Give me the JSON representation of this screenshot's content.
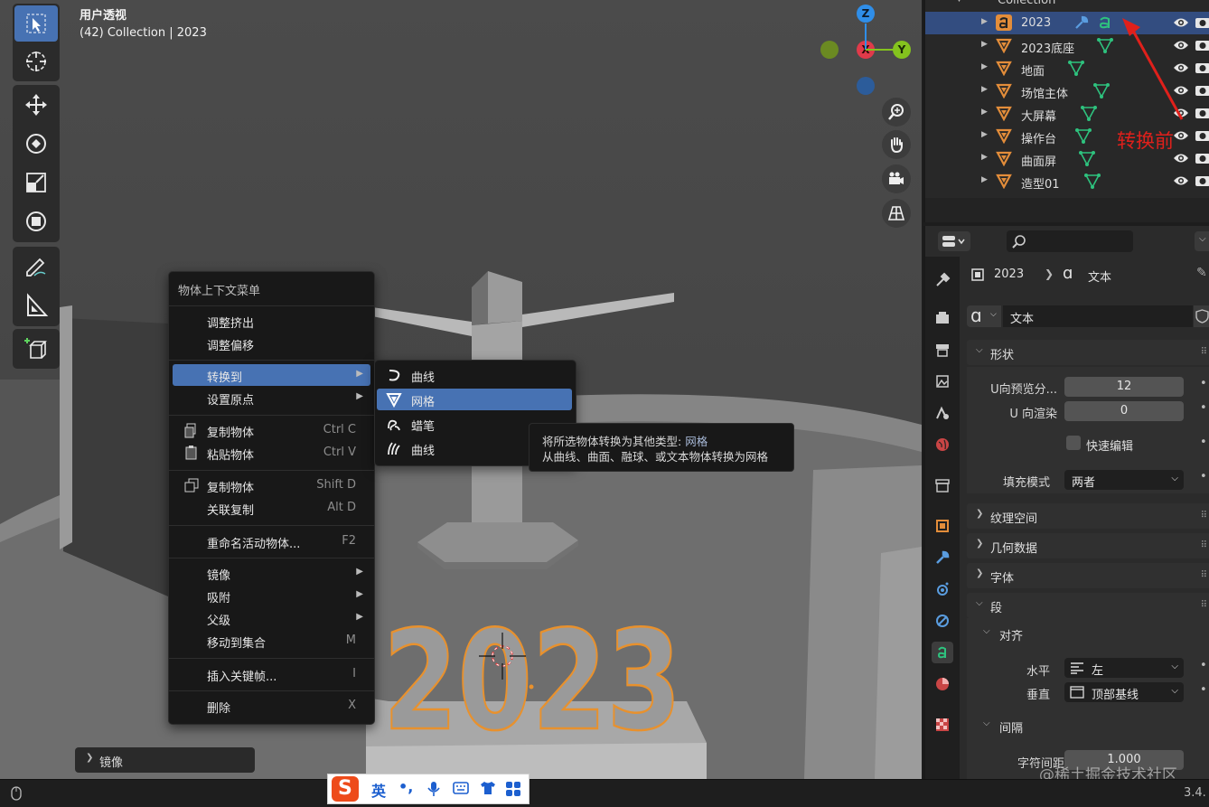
{
  "viewport": {
    "view_name": "用户透视",
    "collection_info": "(42) Collection | 2023",
    "scene_text": "2023"
  },
  "gizmo": {
    "z": "Z",
    "x": "X",
    "y": "Y"
  },
  "context_menu": {
    "title": "物体上下文菜单",
    "items": [
      {
        "label": "调整挤出",
        "shortcut": ""
      },
      {
        "label": "调整偏移",
        "shortcut": ""
      },
      {
        "label": "转换到",
        "shortcut": ""
      },
      {
        "label": "设置原点",
        "shortcut": ""
      },
      {
        "label": "复制物体",
        "shortcut": "Ctrl C"
      },
      {
        "label": "粘贴物体",
        "shortcut": "Ctrl V"
      },
      {
        "label": "复制物体",
        "shortcut": "Shift D"
      },
      {
        "label": "关联复制",
        "shortcut": "Alt D"
      },
      {
        "label": "重命名活动物体...",
        "shortcut": "F2"
      },
      {
        "label": "镜像",
        "shortcut": ""
      },
      {
        "label": "吸附",
        "shortcut": ""
      },
      {
        "label": "父级",
        "shortcut": ""
      },
      {
        "label": "移动到集合",
        "shortcut": "M"
      },
      {
        "label": "插入关键帧...",
        "shortcut": "I"
      },
      {
        "label": "删除",
        "shortcut": "X"
      }
    ]
  },
  "convert_submenu": {
    "items": [
      {
        "label": "曲线"
      },
      {
        "label": "网格"
      },
      {
        "label": "蜡笔"
      },
      {
        "label": "曲线"
      }
    ]
  },
  "tooltip": {
    "line1_prefix": "将所选物体转换为其他类型: ",
    "line1_value": "网格",
    "line2": "从曲线、曲面、融球、或文本物体转换为网格"
  },
  "redo_panel": {
    "label": "镜像"
  },
  "outliner": {
    "collection": "Collection",
    "rows": [
      {
        "name": "2023",
        "type": "text",
        "selected": true
      },
      {
        "name": "2023底座",
        "type": "mesh",
        "selected": false
      },
      {
        "name": "地面",
        "type": "mesh",
        "selected": false
      },
      {
        "name": "场馆主体",
        "type": "mesh",
        "selected": false
      },
      {
        "name": "大屏幕",
        "type": "mesh",
        "selected": false
      },
      {
        "name": "操作台",
        "type": "mesh",
        "selected": false
      },
      {
        "name": "曲面屏",
        "type": "mesh",
        "selected": false
      },
      {
        "name": "造型01",
        "type": "mesh",
        "selected": false
      }
    ],
    "annotation": "转换前"
  },
  "properties": {
    "breadcrumb_object": "2023",
    "breadcrumb_data": "文本",
    "datablock_name": "文本",
    "panels": {
      "shape": "形状",
      "texture_space": "纹理空间",
      "geometry": "几何数据",
      "font": "字体",
      "paragraph": "段",
      "alignment": "对齐",
      "spacing": "间隔"
    },
    "u_preview_label": "U向预览分...",
    "u_preview_value": "12",
    "u_render_label": "U 向渲染",
    "u_render_value": "0",
    "fast_edit_label": "快速编辑",
    "fill_mode_label": "填充模式",
    "fill_mode_value": "两者",
    "horizontal_label": "水平",
    "horizontal_value": "左",
    "vertical_label": "垂直",
    "vertical_value": "顶部基线",
    "char_spacing_label": "字符间距",
    "char_spacing_value": "1.000"
  },
  "ime": {
    "lang": "英"
  },
  "statusbar": {
    "version": "3.4."
  },
  "watermark": "@稀土掘金技术社区",
  "colors": {
    "accent": "#4772b3",
    "selected_row": "#334d80",
    "outline_orange": "#e8912d",
    "annotation_red": "#e0201b",
    "mesh_green": "#2ec27e",
    "object_orange": "#e38d3a"
  }
}
